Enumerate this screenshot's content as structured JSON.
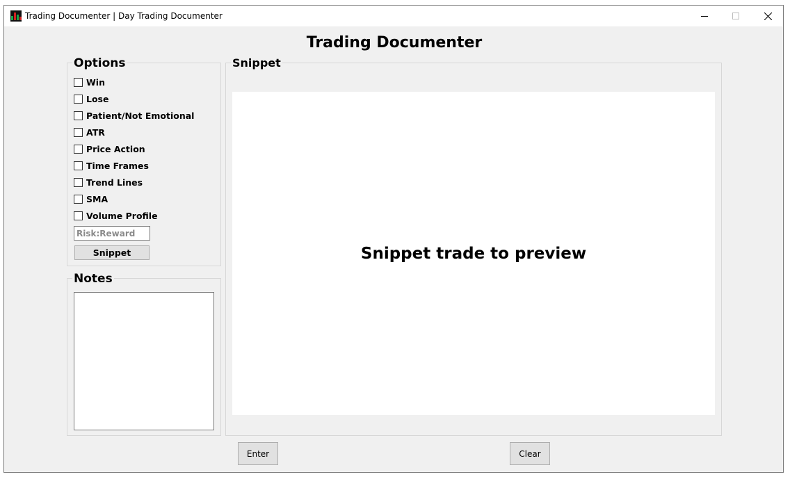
{
  "window": {
    "title": "Trading Documenter | Day Trading Documenter",
    "icon": "chart-candles-icon"
  },
  "heading": "Trading Documenter",
  "options": {
    "label": "Options",
    "items": [
      {
        "label": "Win",
        "checked": false
      },
      {
        "label": "Lose",
        "checked": false
      },
      {
        "label": "Patient/Not Emotional",
        "checked": false
      },
      {
        "label": "ATR",
        "checked": false
      },
      {
        "label": "Price Action",
        "checked": false
      },
      {
        "label": "Time Frames",
        "checked": false
      },
      {
        "label": "Trend Lines",
        "checked": false
      },
      {
        "label": "SMA",
        "checked": false
      },
      {
        "label": "Volume Profile",
        "checked": false
      }
    ],
    "risk_reward_placeholder": "Risk:Reward",
    "snippet_button": "Snippet"
  },
  "notes": {
    "label": "Notes",
    "value": ""
  },
  "snippet": {
    "label": "Snippet",
    "preview_text": "Snippet trade to preview"
  },
  "actions": {
    "enter": "Enter",
    "clear": "Clear"
  }
}
